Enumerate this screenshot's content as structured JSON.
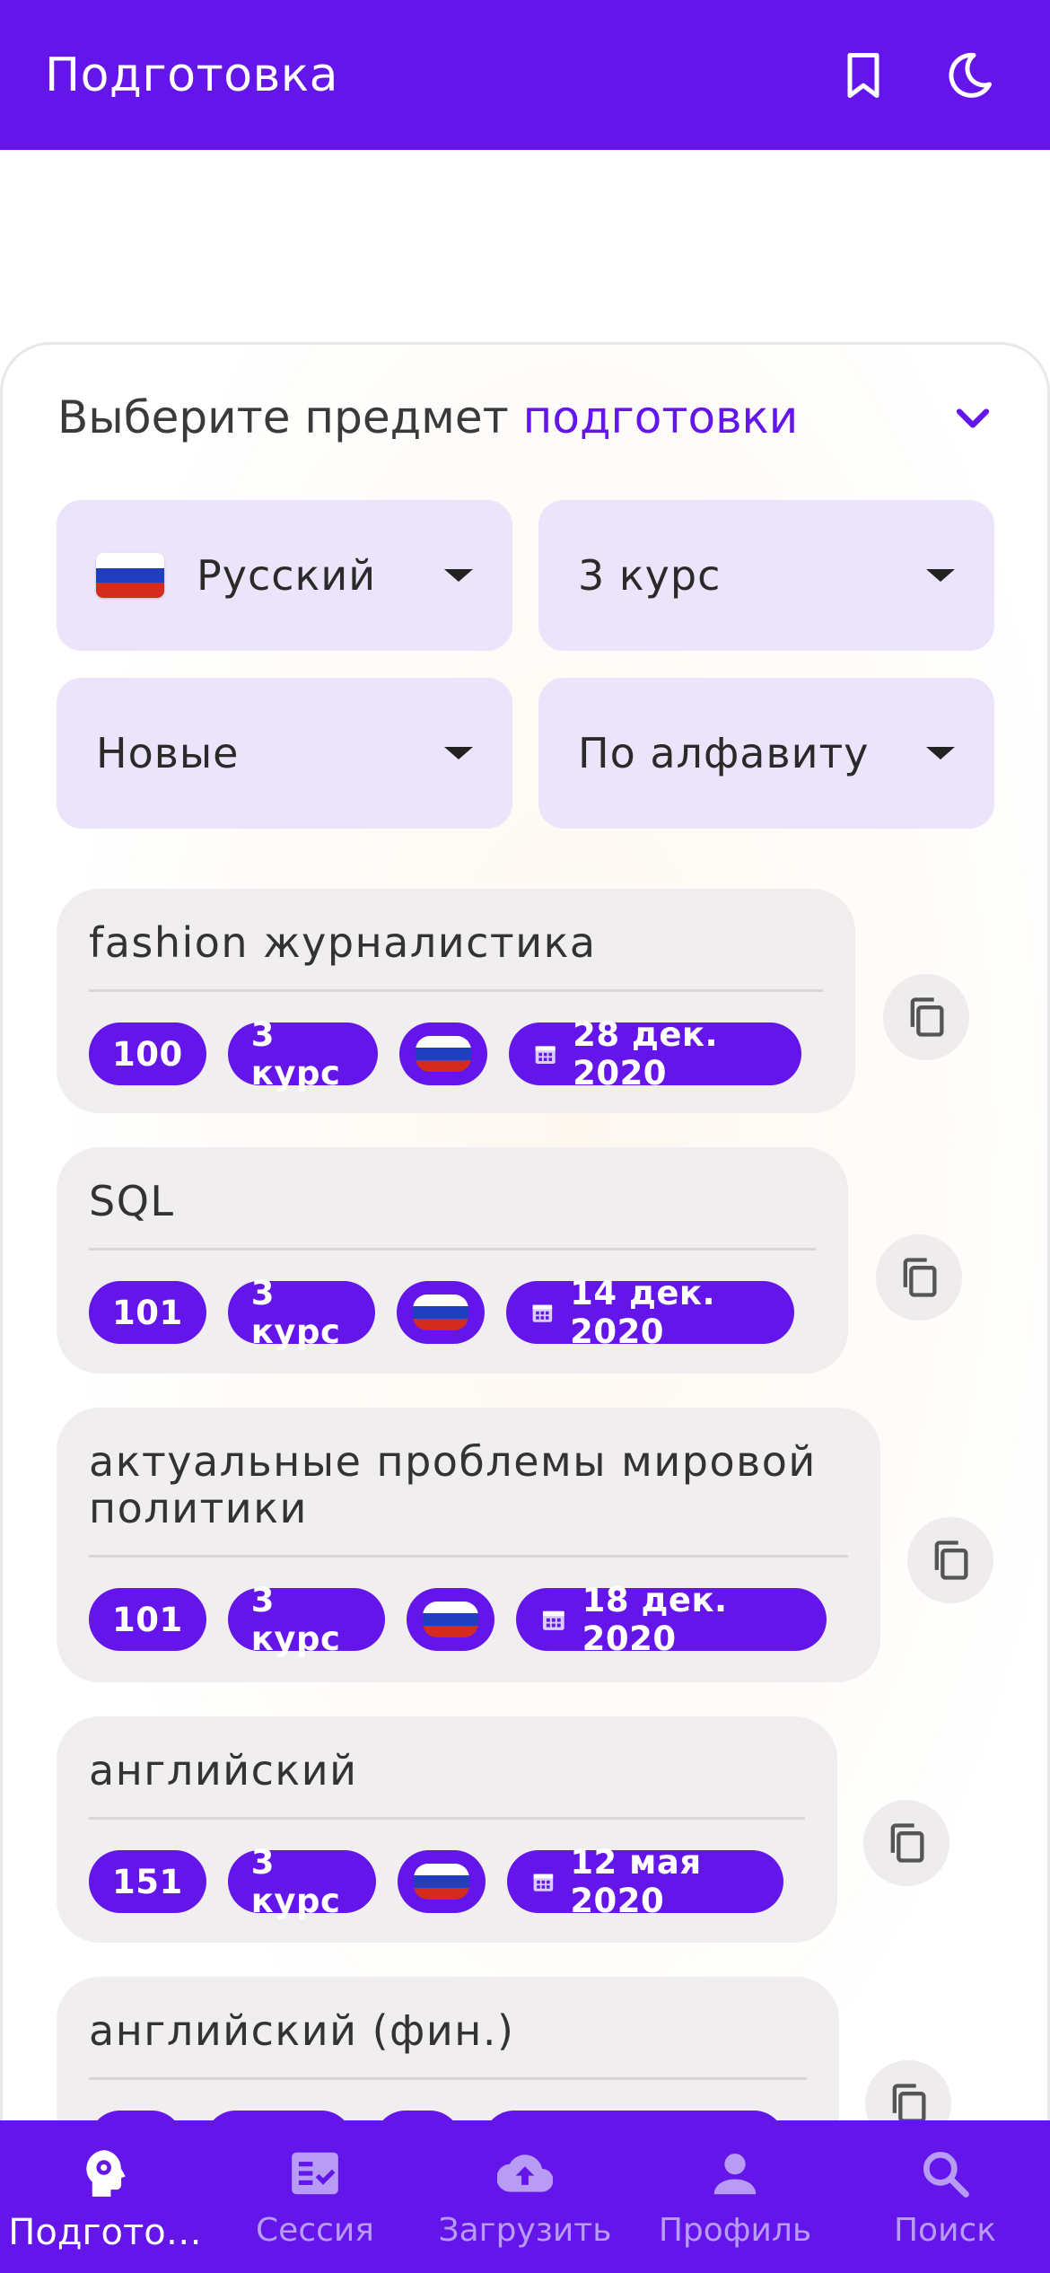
{
  "appbar": {
    "title": "Подготовка",
    "icons": [
      "bookmark-icon",
      "moon-icon"
    ]
  },
  "subject_card": {
    "title_prefix": "Выберите предмет ",
    "title_accent": "подготовки"
  },
  "filters": {
    "language": "Русский",
    "course": "3 курс",
    "type": "Новые",
    "sort": "По алфавиту"
  },
  "items": [
    {
      "title": "fashion журналистика",
      "count": "100",
      "course": "3 курс",
      "date": "28 дек. 2020"
    },
    {
      "title": "SQL",
      "count": "101",
      "course": "3 курс",
      "date": "14 дек. 2020"
    },
    {
      "title": "актуальные проблемы мировой политики",
      "count": "101",
      "course": "3 курс",
      "date": "18 дек. 2020"
    },
    {
      "title": "английский",
      "count": "151",
      "course": "3 курс",
      "date": "12 мая 2020"
    },
    {
      "title": "английский (фин.)",
      "count": "",
      "course": "",
      "date": ""
    }
  ],
  "bottom_nav": [
    {
      "label": "Подгото…",
      "icon": "head-gear-icon",
      "active": true
    },
    {
      "label": "Сессия",
      "icon": "checklist-icon",
      "active": false
    },
    {
      "label": "Загрузить",
      "icon": "cloud-upload-icon",
      "active": false
    },
    {
      "label": "Профиль",
      "icon": "person-icon",
      "active": false
    },
    {
      "label": "Поиск",
      "icon": "search-icon",
      "active": false
    }
  ],
  "colors": {
    "primary": "#6415ea",
    "filter_bg": "#ece4fb",
    "item_bg": "#f0eeee"
  }
}
